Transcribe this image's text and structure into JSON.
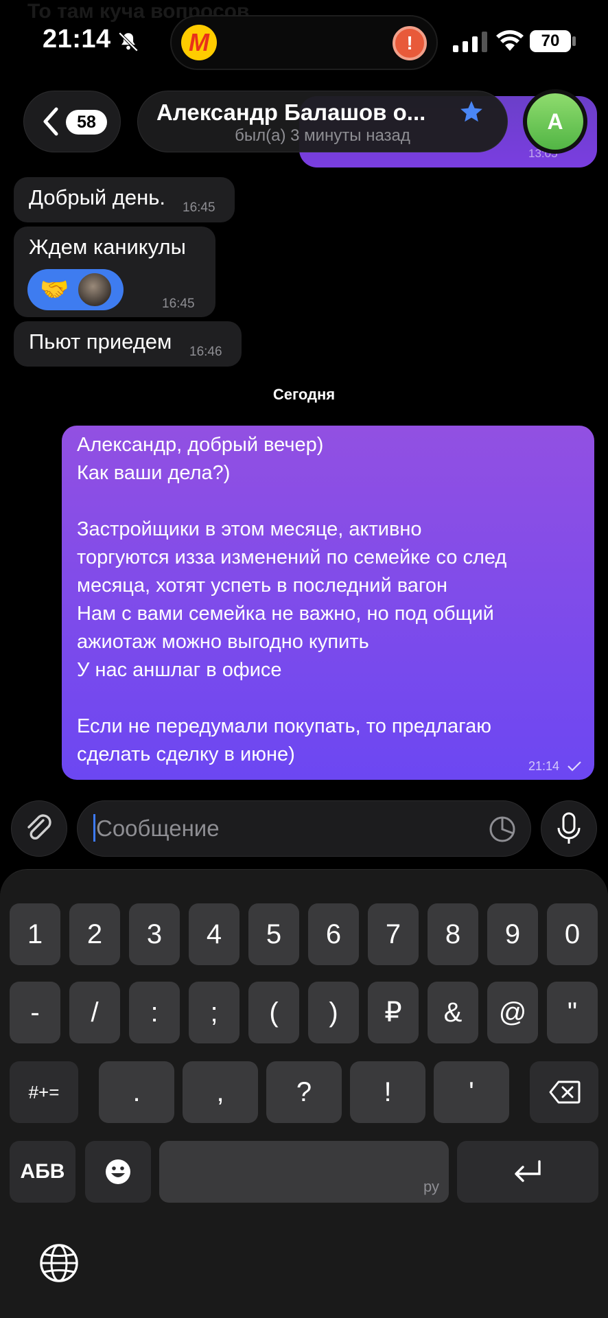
{
  "ghost_text": "То там куча вопросов",
  "status_bar": {
    "time": "21:14",
    "battery": "70",
    "island_app_letter": "M",
    "island_alert": "!"
  },
  "header": {
    "back_count": "58",
    "title": "Александр Балашов о...",
    "subtitle": "был(а) 3 минуты назад",
    "avatar_letter": "А",
    "peek_time": "13:05"
  },
  "messages": {
    "incoming": [
      {
        "text": "Добрый день.",
        "time": "16:45"
      },
      {
        "text": "Ждем каникулы",
        "time": "16:45",
        "reaction": "🤝"
      },
      {
        "text": "Пьют приедем",
        "time": "16:46"
      }
    ],
    "date_separator": "Сегодня",
    "outgoing": {
      "lines": [
        "Александр, добрый вечер)",
        "Как ваши дела?)",
        "",
        "Застройщики в этом месяце, активно",
        "торгуются изза изменений по семейке со след",
        "месяца, хотят успеть в последний вагон",
        "Нам с вами семейка не важно, но под общий",
        "ажиотаж можно выгодно купить",
        "У нас аншлаг в офисе",
        "",
        "Если не передумали покупать, то предлагаю",
        "сделать сделку в июне)"
      ],
      "time": "21:14"
    }
  },
  "input": {
    "placeholder": "Сообщение"
  },
  "keyboard": {
    "row1": [
      "1",
      "2",
      "3",
      "4",
      "5",
      "6",
      "7",
      "8",
      "9",
      "0"
    ],
    "row2": [
      "-",
      "/",
      ":",
      ";",
      "(",
      ")",
      "₽",
      "&",
      "@",
      "\""
    ],
    "row3": [
      "#+=",
      ".",
      ",",
      "?",
      "!",
      "'"
    ],
    "row4": {
      "abc": "АБВ",
      "space_lang": "ру"
    }
  },
  "colors": {
    "accent_purple": "#7a4be8",
    "incoming_bubble": "#1f1f21",
    "reaction_blue": "#3e7cf0",
    "avatar_green": "#5cc04e"
  }
}
